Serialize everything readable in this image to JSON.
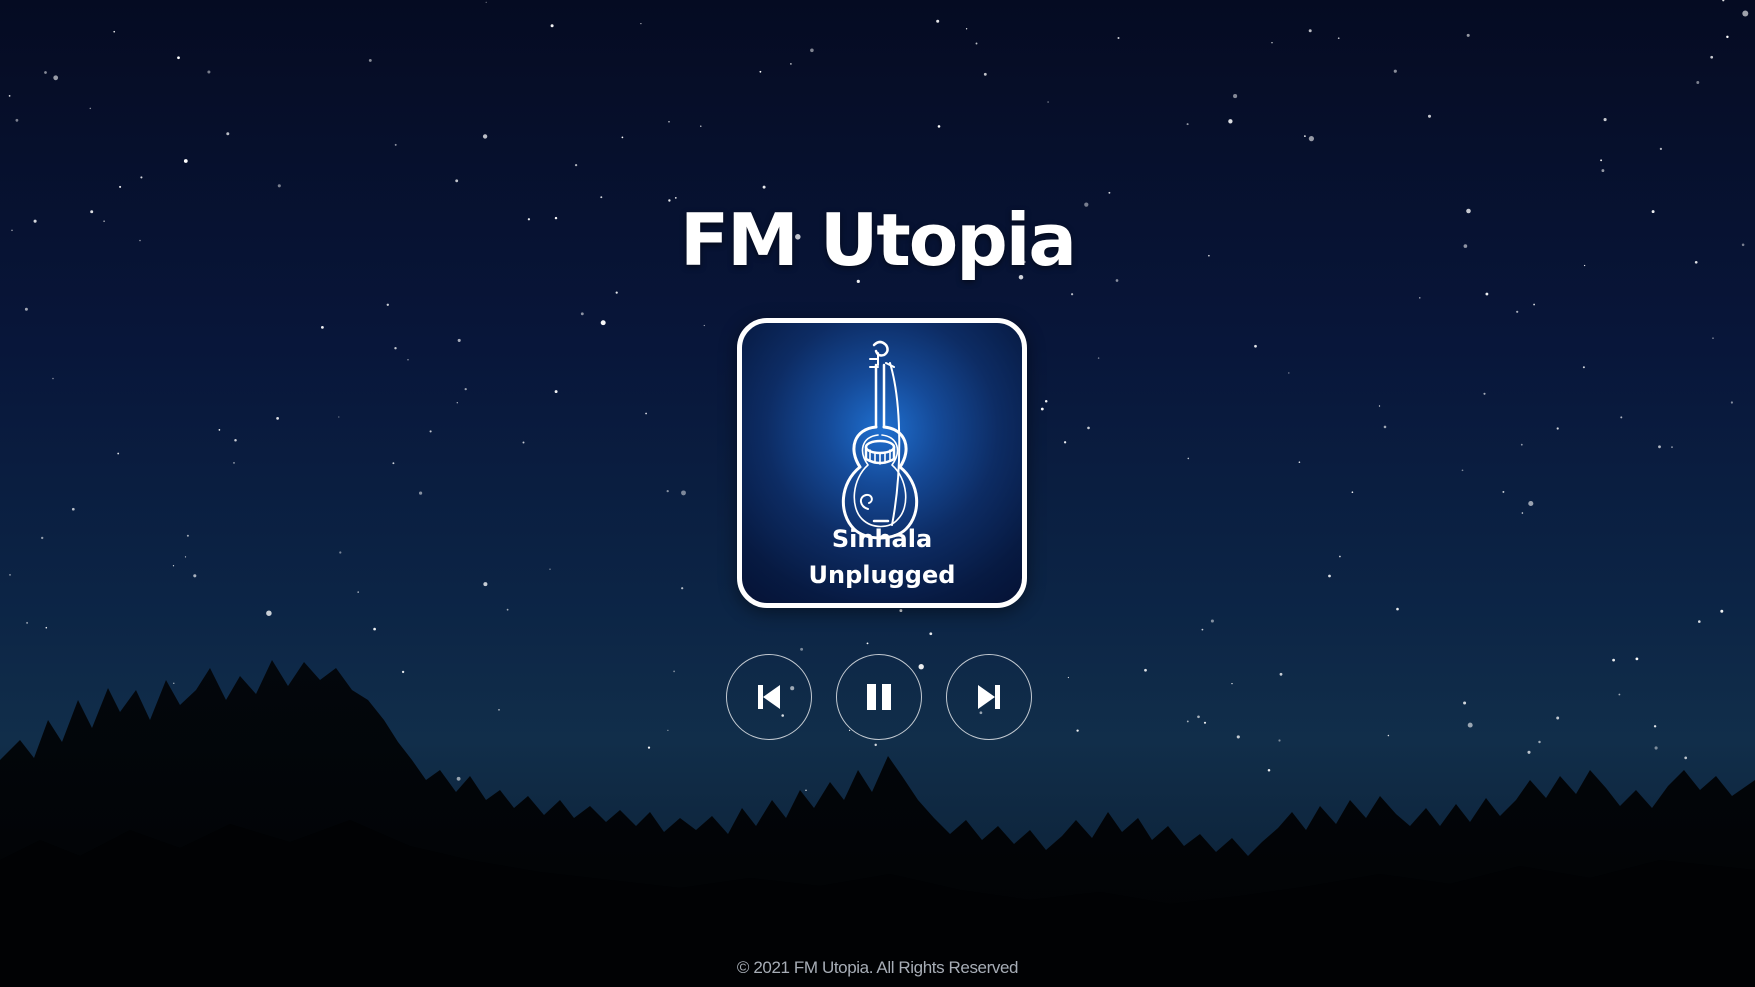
{
  "app": {
    "title": "FM Utopia"
  },
  "station": {
    "name_line1": "Sinhala",
    "name_line2": "Unplugged"
  },
  "controls": {
    "previous_icon": "skip-previous-icon",
    "pause_icon": "pause-icon",
    "next_icon": "skip-next-icon"
  },
  "footer": {
    "copyright": "© 2021 FM Utopia.  All Rights Reserved"
  },
  "colors": {
    "title": "#ffffff",
    "card_border": "#ffffff",
    "footer_text": "#a7adb6"
  }
}
